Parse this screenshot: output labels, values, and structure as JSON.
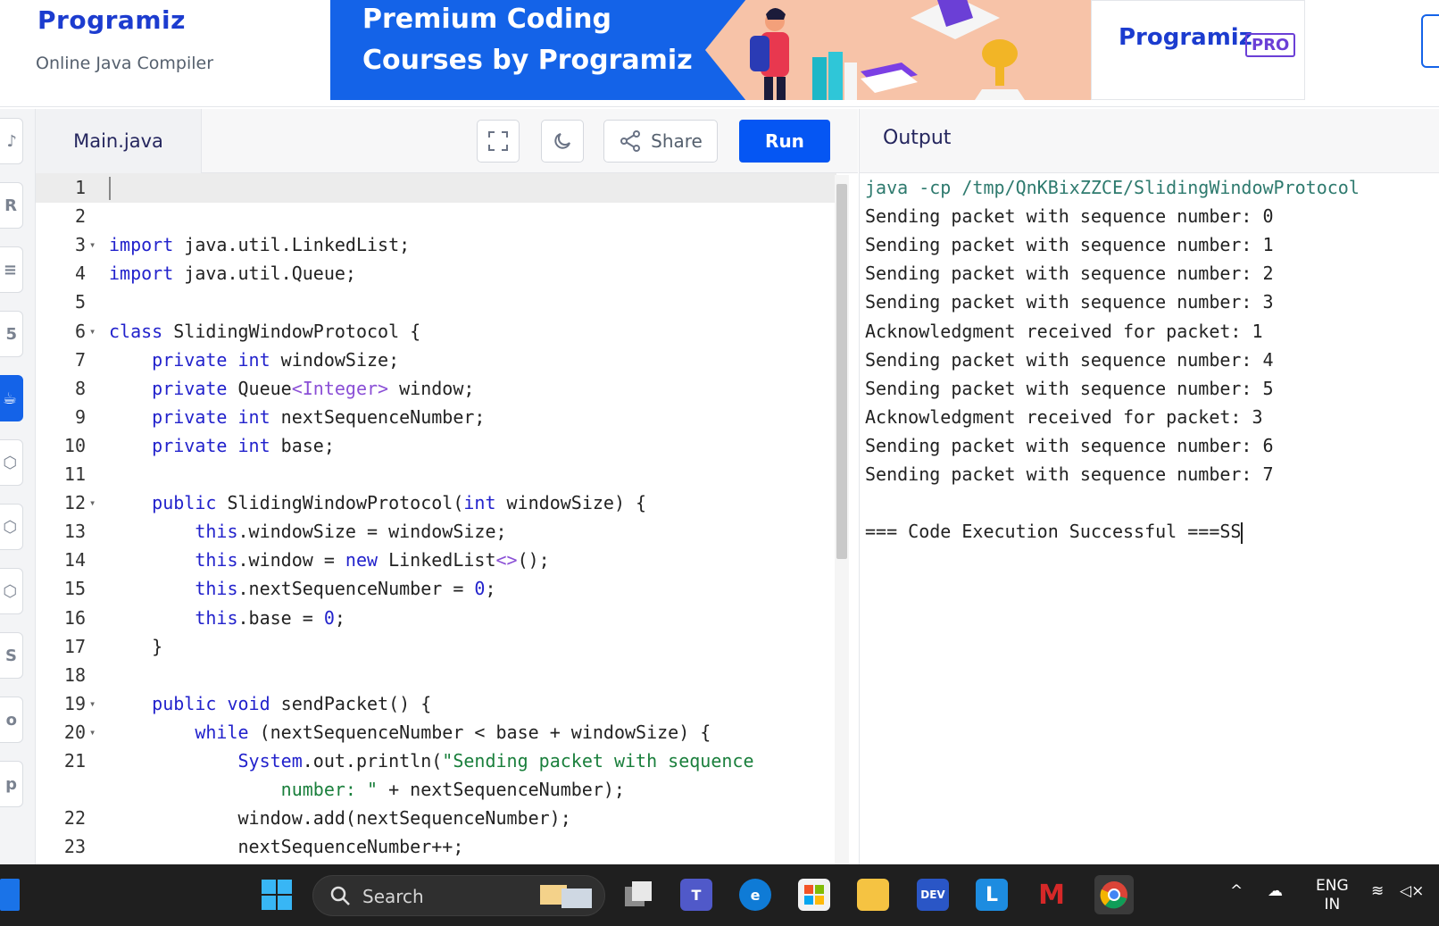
{
  "header": {
    "logo_text": "Programiz",
    "subtitle": "Online Java Compiler"
  },
  "banner": {
    "line1": "Premium Coding",
    "line2": "Courses by Programiz",
    "brand": "Programiz",
    "badge": "PRO"
  },
  "editor": {
    "file_tab": "Main.java",
    "share_label": "Share",
    "run_label": "Run",
    "lines": [
      {
        "n": "1",
        "fold": false,
        "html": ""
      },
      {
        "n": "2",
        "fold": false,
        "html": ""
      },
      {
        "n": "3",
        "fold": true,
        "html": "<span class=\"kw\">import</span> java.util.LinkedList;"
      },
      {
        "n": "4",
        "fold": false,
        "html": "<span class=\"kw\">import</span> java.util.Queue;"
      },
      {
        "n": "5",
        "fold": false,
        "html": ""
      },
      {
        "n": "6",
        "fold": true,
        "html": "<span class=\"kw\">class</span> SlidingWindowProtocol {"
      },
      {
        "n": "7",
        "fold": false,
        "html": "    <span class=\"kw\">private</span> <span class=\"kw\">int</span> windowSize;"
      },
      {
        "n": "8",
        "fold": false,
        "html": "    <span class=\"kw\">private</span> Queue<span class=\"gn\">&lt;Integer&gt;</span> window;"
      },
      {
        "n": "9",
        "fold": false,
        "html": "    <span class=\"kw\">private</span> <span class=\"kw\">int</span> nextSequenceNumber;"
      },
      {
        "n": "10",
        "fold": false,
        "html": "    <span class=\"kw\">private</span> <span class=\"kw\">int</span> base;"
      },
      {
        "n": "11",
        "fold": false,
        "html": ""
      },
      {
        "n": "12",
        "fold": true,
        "html": "    <span class=\"kw\">public</span> SlidingWindowProtocol(<span class=\"kw\">int</span> windowSize) {"
      },
      {
        "n": "13",
        "fold": false,
        "html": "        <span class=\"kw\">this</span>.windowSize = windowSize;"
      },
      {
        "n": "14",
        "fold": false,
        "html": "        <span class=\"kw\">this</span>.window = <span class=\"kw\">new</span> LinkedList<span class=\"gn\">&lt;&gt;</span>();"
      },
      {
        "n": "15",
        "fold": false,
        "html": "        <span class=\"kw\">this</span>.nextSequenceNumber = <span class=\"kw\">0</span>;"
      },
      {
        "n": "16",
        "fold": false,
        "html": "        <span class=\"kw\">this</span>.base = <span class=\"kw\">0</span>;"
      },
      {
        "n": "17",
        "fold": false,
        "html": "    }"
      },
      {
        "n": "18",
        "fold": false,
        "html": ""
      },
      {
        "n": "19",
        "fold": true,
        "html": "    <span class=\"kw\">public</span> <span class=\"kw\">void</span> sendPacket() {"
      },
      {
        "n": "20",
        "fold": true,
        "html": "        <span class=\"kw\">while</span> (nextSequenceNumber &lt; base + windowSize) {"
      },
      {
        "n": "21",
        "fold": false,
        "html": "            <span class=\"kw\">System</span>.out.println(<span class=\"st\">\"Sending packet with sequence</span>"
      },
      {
        "n": "",
        "fold": false,
        "html": "                <span class=\"st\">number: \"</span> + nextSequenceNumber);"
      },
      {
        "n": "22",
        "fold": false,
        "html": "            window.add(nextSequenceNumber);"
      },
      {
        "n": "23",
        "fold": false,
        "html": "            nextSequenceNumber++;"
      }
    ]
  },
  "output": {
    "title": "Output",
    "command": "java -cp /tmp/QnKBixZZCE/SlidingWindowProtocol",
    "lines": [
      "Sending packet with sequence number: 0",
      "Sending packet with sequence number: 1",
      "Sending packet with sequence number: 2",
      "Sending packet with sequence number: 3",
      "Acknowledgment received for packet: 1",
      "Sending packet with sequence number: 4",
      "Sending packet with sequence number: 5",
      "Acknowledgment received for packet: 3",
      "Sending packet with sequence number: 6",
      "Sending packet with sequence number: 7",
      "",
      "=== Code Execution Successful ===SS"
    ]
  },
  "taskbar": {
    "search_placeholder": "Search",
    "lang_top": "ENG",
    "lang_bottom": "IN",
    "icons": [
      "widgets-icon",
      "start-icon",
      "task-view-icon",
      "teams-icon",
      "edge-icon",
      "store-icon",
      "file-explorer-icon",
      "devcpp-icon",
      "l-app-icon",
      "mcafee-icon",
      "chrome-icon"
    ]
  },
  "colors": {
    "accent": "#0556f3",
    "keyword": "#2222cc",
    "string": "#1a7f3c",
    "command": "#2e7a6e"
  }
}
